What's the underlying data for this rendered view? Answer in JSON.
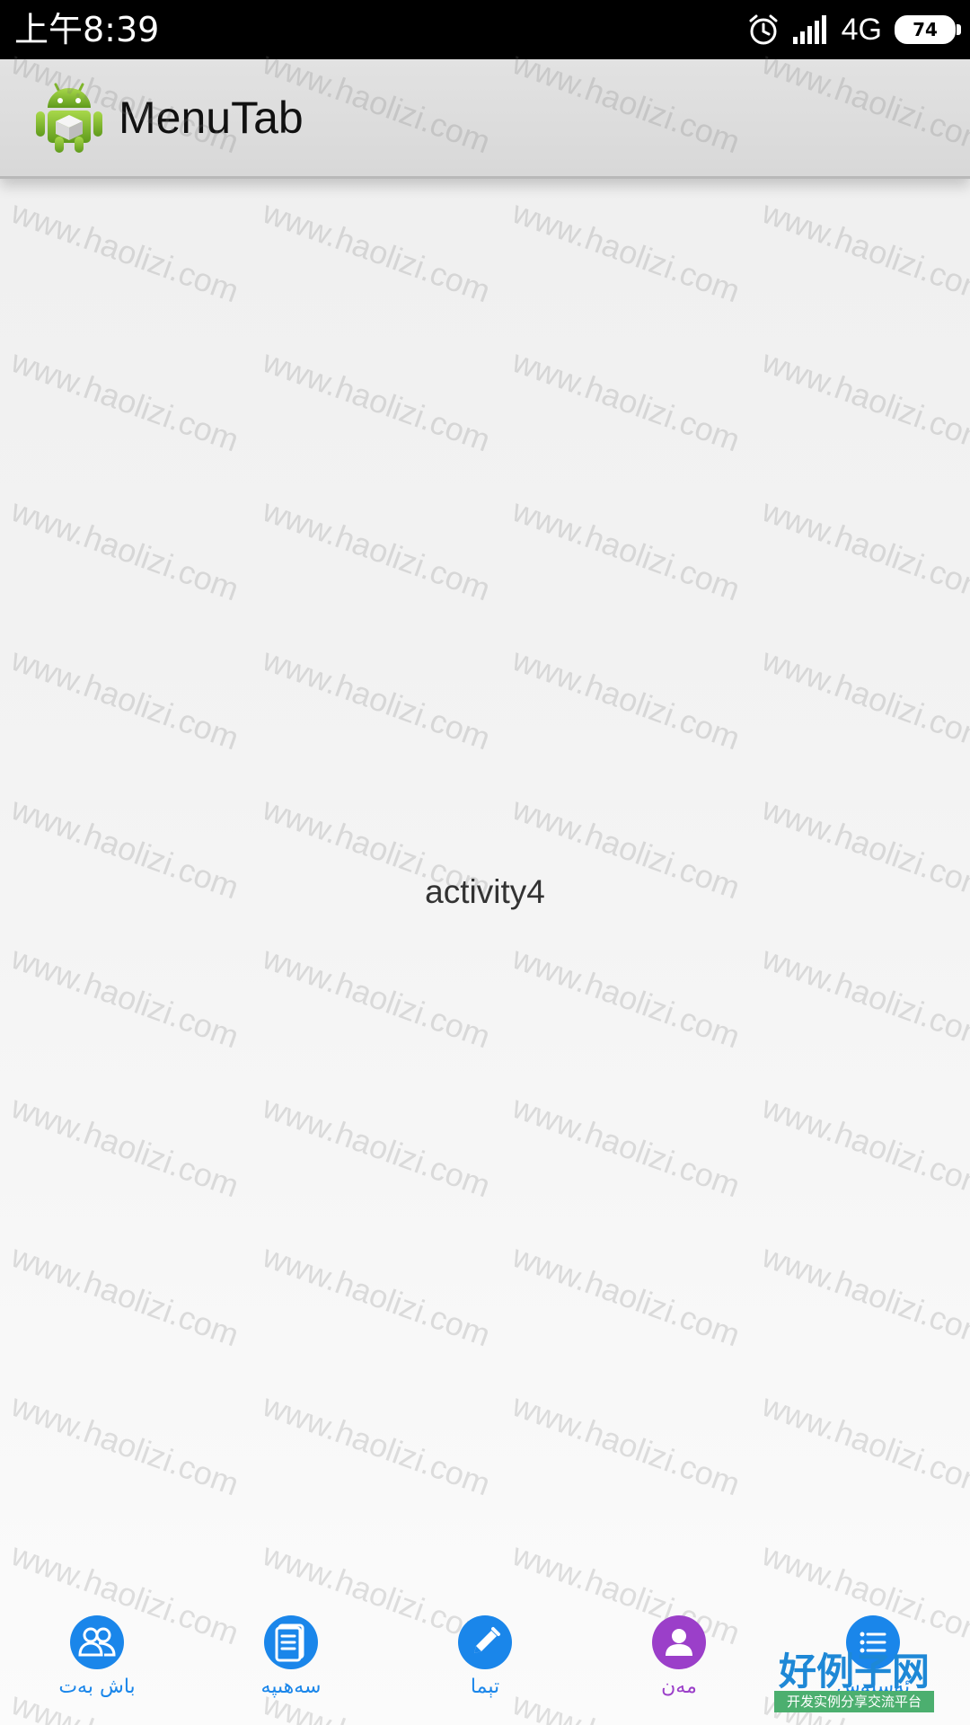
{
  "status_bar": {
    "time": "上午8:39",
    "network": "4G",
    "battery": "74",
    "icons": [
      "alarm-icon",
      "signal-icon",
      "battery-icon"
    ]
  },
  "action_bar": {
    "title": "MenuTab",
    "icon": "android-icon"
  },
  "main": {
    "text": "activity4"
  },
  "watermark": {
    "text": "www.haolizi.com"
  },
  "tabs": [
    {
      "label": "باش بەت",
      "icon": "users-icon",
      "color": "#1a86ea",
      "label_color": "#1a86ea"
    },
    {
      "label": "سەھىپە",
      "icon": "document-icon",
      "color": "#1a86ea",
      "label_color": "#1a86ea"
    },
    {
      "label": "تېما",
      "icon": "pencil-icon",
      "color": "#1a86ea",
      "label_color": "#1a86ea"
    },
    {
      "label": "مەن",
      "icon": "person-icon",
      "color": "#9b3fc9",
      "label_color": "#9b3fc9"
    },
    {
      "label": "ئەسلەش",
      "icon": "list-icon",
      "color": "#1a86ea",
      "label_color": "#1a86ea"
    }
  ],
  "corner_logo": {
    "main": "好例子网",
    "sub": "开发实例分享交流平台"
  }
}
